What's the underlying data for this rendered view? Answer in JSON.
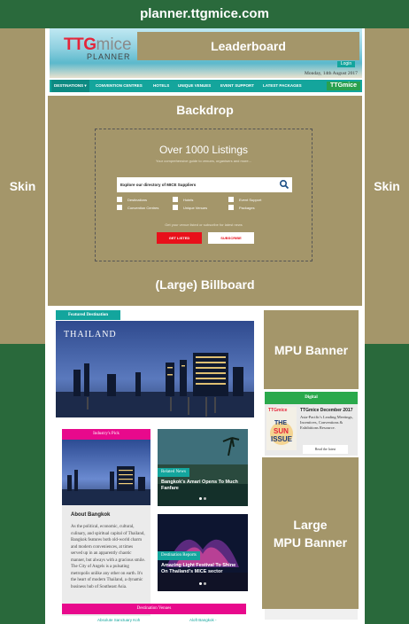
{
  "site": {
    "domain": "planner.ttgmice.com"
  },
  "ad_slots": {
    "skin_left": "Skin",
    "skin_right": "Skin",
    "leaderboard": "Leaderboard",
    "backdrop": "Backdrop",
    "billboard": "(Large) Billboard",
    "mpu": "MPU Banner",
    "large_mpu_line1": "Large",
    "large_mpu_line2": "MPU Banner"
  },
  "header": {
    "logo_ttg": "TTG",
    "logo_mice": "mice",
    "logo_planner": "PLANNER",
    "login_label": "Login",
    "date": "Monday, 14th August 2017"
  },
  "nav": {
    "items": [
      "DESTINATIONS ▾",
      "CONVENTION CENTRES",
      "HOTELS",
      "UNIQUE VENUES",
      "EVENT SUPPORT",
      "LATEST PACKAGES"
    ],
    "logo_ttg": "TTG",
    "logo_mice": "mice"
  },
  "listings": {
    "title": "Over 1000 Listings",
    "subtitle": "Your comprehensive guide to venues, organisers and more...",
    "search_placeholder": "Explore our directory of MICE Suppliers",
    "checks": [
      "Destinations",
      "Convention Centres",
      "Hotels",
      "Unique Venues",
      "Event Support",
      "Packages"
    ],
    "newsletter": "Get your venue listed or subscribe for latest news",
    "get_listed": "GET LISTED",
    "subscribe": "SUBSCRIBE"
  },
  "featured": {
    "tab": "Featured Destination",
    "label": "THAILAND"
  },
  "digital": {
    "head": "Digital",
    "cover_brand": "TTGmice",
    "cover_title_1": "THE",
    "cover_title_2": "SUN",
    "cover_title_3": "ISSUE",
    "title": "TTGmice December 2017",
    "desc": "Asia-Pacific's Leading Meetings, Incentives, Conventions & Exhibitions Resource.",
    "read_label": "Read the latest"
  },
  "industry_pick": {
    "head": "Industry's Pick",
    "title": "About Bangkok",
    "body": "As the political, economic, cultural, culinary, and spiritual capital of Thailand, Bangkok features both old-world charm and modern conveniences, at times served up in an apparently chaotic manner, but always with a gracious smile. The City of Angels is a pulsating metropolis unlike any other on earth. It's the heart of modern Thailand, a dynamic business hub of Southeast Asia."
  },
  "news": {
    "related_tab": "Related News",
    "related_title": "Bangkok's Amari Opens To Much Fanfare",
    "reports_tab": "Destination Reports",
    "reports_title": "Amazing Light Festival To Shine On Thailand's MICE sector"
  },
  "venues": {
    "head": "Destination Venues",
    "left": "Absolute Sanctuary Koh",
    "right": "Aloft Bangkok -"
  },
  "colors": {
    "placeholder": "#a4966a",
    "teal": "#13a59d",
    "magenta": "#e8098c",
    "background": "#29693b"
  }
}
